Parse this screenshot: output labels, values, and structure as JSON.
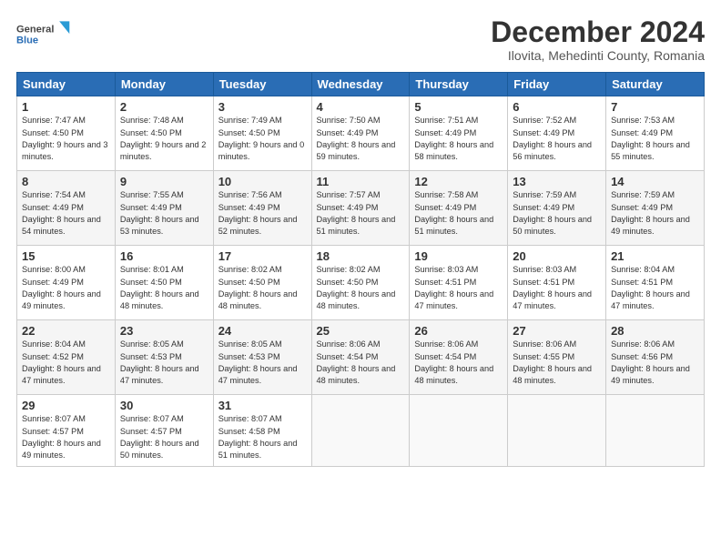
{
  "logo": {
    "general": "General",
    "blue": "Blue"
  },
  "title": "December 2024",
  "subtitle": "Ilovita, Mehedinti County, Romania",
  "days_of_week": [
    "Sunday",
    "Monday",
    "Tuesday",
    "Wednesday",
    "Thursday",
    "Friday",
    "Saturday"
  ],
  "weeks": [
    [
      {
        "day": "1",
        "sunrise": "7:47 AM",
        "sunset": "4:50 PM",
        "daylight": "9 hours and 3 minutes."
      },
      {
        "day": "2",
        "sunrise": "7:48 AM",
        "sunset": "4:50 PM",
        "daylight": "9 hours and 2 minutes."
      },
      {
        "day": "3",
        "sunrise": "7:49 AM",
        "sunset": "4:50 PM",
        "daylight": "9 hours and 0 minutes."
      },
      {
        "day": "4",
        "sunrise": "7:50 AM",
        "sunset": "4:49 PM",
        "daylight": "8 hours and 59 minutes."
      },
      {
        "day": "5",
        "sunrise": "7:51 AM",
        "sunset": "4:49 PM",
        "daylight": "8 hours and 58 minutes."
      },
      {
        "day": "6",
        "sunrise": "7:52 AM",
        "sunset": "4:49 PM",
        "daylight": "8 hours and 56 minutes."
      },
      {
        "day": "7",
        "sunrise": "7:53 AM",
        "sunset": "4:49 PM",
        "daylight": "8 hours and 55 minutes."
      }
    ],
    [
      {
        "day": "8",
        "sunrise": "7:54 AM",
        "sunset": "4:49 PM",
        "daylight": "8 hours and 54 minutes."
      },
      {
        "day": "9",
        "sunrise": "7:55 AM",
        "sunset": "4:49 PM",
        "daylight": "8 hours and 53 minutes."
      },
      {
        "day": "10",
        "sunrise": "7:56 AM",
        "sunset": "4:49 PM",
        "daylight": "8 hours and 52 minutes."
      },
      {
        "day": "11",
        "sunrise": "7:57 AM",
        "sunset": "4:49 PM",
        "daylight": "8 hours and 51 minutes."
      },
      {
        "day": "12",
        "sunrise": "7:58 AM",
        "sunset": "4:49 PM",
        "daylight": "8 hours and 51 minutes."
      },
      {
        "day": "13",
        "sunrise": "7:59 AM",
        "sunset": "4:49 PM",
        "daylight": "8 hours and 50 minutes."
      },
      {
        "day": "14",
        "sunrise": "7:59 AM",
        "sunset": "4:49 PM",
        "daylight": "8 hours and 49 minutes."
      }
    ],
    [
      {
        "day": "15",
        "sunrise": "8:00 AM",
        "sunset": "4:49 PM",
        "daylight": "8 hours and 49 minutes."
      },
      {
        "day": "16",
        "sunrise": "8:01 AM",
        "sunset": "4:50 PM",
        "daylight": "8 hours and 48 minutes."
      },
      {
        "day": "17",
        "sunrise": "8:02 AM",
        "sunset": "4:50 PM",
        "daylight": "8 hours and 48 minutes."
      },
      {
        "day": "18",
        "sunrise": "8:02 AM",
        "sunset": "4:50 PM",
        "daylight": "8 hours and 48 minutes."
      },
      {
        "day": "19",
        "sunrise": "8:03 AM",
        "sunset": "4:51 PM",
        "daylight": "8 hours and 47 minutes."
      },
      {
        "day": "20",
        "sunrise": "8:03 AM",
        "sunset": "4:51 PM",
        "daylight": "8 hours and 47 minutes."
      },
      {
        "day": "21",
        "sunrise": "8:04 AM",
        "sunset": "4:51 PM",
        "daylight": "8 hours and 47 minutes."
      }
    ],
    [
      {
        "day": "22",
        "sunrise": "8:04 AM",
        "sunset": "4:52 PM",
        "daylight": "8 hours and 47 minutes."
      },
      {
        "day": "23",
        "sunrise": "8:05 AM",
        "sunset": "4:53 PM",
        "daylight": "8 hours and 47 minutes."
      },
      {
        "day": "24",
        "sunrise": "8:05 AM",
        "sunset": "4:53 PM",
        "daylight": "8 hours and 47 minutes."
      },
      {
        "day": "25",
        "sunrise": "8:06 AM",
        "sunset": "4:54 PM",
        "daylight": "8 hours and 48 minutes."
      },
      {
        "day": "26",
        "sunrise": "8:06 AM",
        "sunset": "4:54 PM",
        "daylight": "8 hours and 48 minutes."
      },
      {
        "day": "27",
        "sunrise": "8:06 AM",
        "sunset": "4:55 PM",
        "daylight": "8 hours and 48 minutes."
      },
      {
        "day": "28",
        "sunrise": "8:06 AM",
        "sunset": "4:56 PM",
        "daylight": "8 hours and 49 minutes."
      }
    ],
    [
      {
        "day": "29",
        "sunrise": "8:07 AM",
        "sunset": "4:57 PM",
        "daylight": "8 hours and 49 minutes."
      },
      {
        "day": "30",
        "sunrise": "8:07 AM",
        "sunset": "4:57 PM",
        "daylight": "8 hours and 50 minutes."
      },
      {
        "day": "31",
        "sunrise": "8:07 AM",
        "sunset": "4:58 PM",
        "daylight": "8 hours and 51 minutes."
      },
      null,
      null,
      null,
      null
    ]
  ]
}
